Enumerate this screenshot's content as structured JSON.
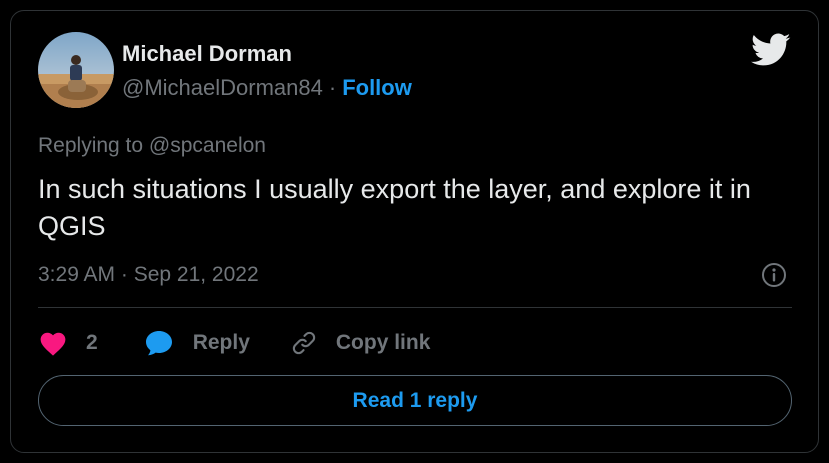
{
  "author": {
    "name": "Michael Dorman",
    "handle": "@MichaelDorman84",
    "separator": "·",
    "follow_label": "Follow"
  },
  "reply_context": {
    "prefix": "Replying to",
    "mention": "@spcanelon"
  },
  "tweet": {
    "text": "In such situations I usually export the layer, and explore it in QGIS",
    "timestamp": "3:29 AM · Sep 21, 2022"
  },
  "actions": {
    "like_count": "2",
    "reply_label": "Reply",
    "copy_link_label": "Copy link",
    "read_replies_label": "Read 1 reply"
  },
  "icons": {
    "brand": "twitter-bird-icon",
    "like": "heart-icon",
    "reply": "speech-bubble-icon",
    "copy": "link-icon",
    "info": "info-icon"
  },
  "colors": {
    "background": "#000000",
    "primary_text": "#e7e9ea",
    "secondary_text": "#71767b",
    "accent_blue": "#1d9bf0",
    "like_pink": "#f91880",
    "border": "#2f3336"
  }
}
